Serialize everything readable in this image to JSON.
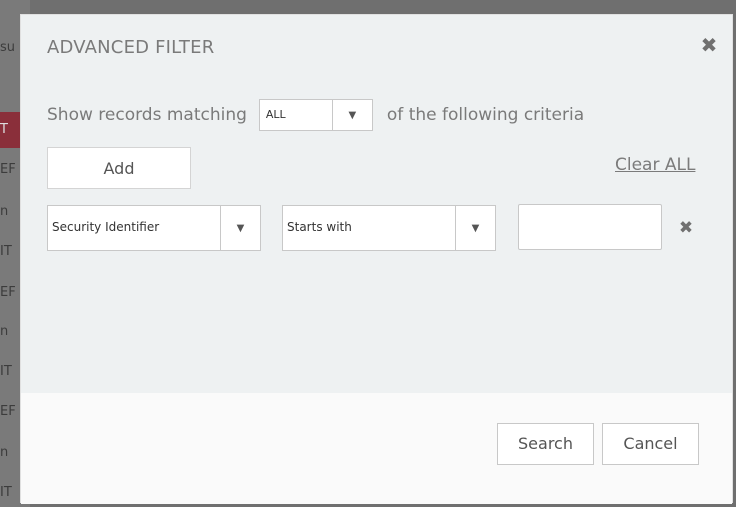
{
  "background_fragments": [
    "su",
    "T",
    "EF",
    "n",
    "IT",
    "EF",
    "n",
    "IT",
    "EF",
    "n",
    "IT"
  ],
  "dialog": {
    "title": "ADVANCED FILTER",
    "close_icon": "close-icon",
    "match": {
      "prefix": "Show records matching",
      "selected": "ALL",
      "suffix": "of the following criteria"
    },
    "add_label": "Add",
    "clear_all_label": "Clear ALL",
    "criteria": [
      {
        "field": "Security Identifier",
        "operator": "Starts with",
        "value": ""
      }
    ],
    "search_label": "Search",
    "cancel_label": "Cancel"
  },
  "colors": {
    "overlay": "#6f6f6f",
    "dialog_bg": "#eef1f2",
    "footer_bg": "#fafafa",
    "accent_red": "#8a2f3a"
  }
}
